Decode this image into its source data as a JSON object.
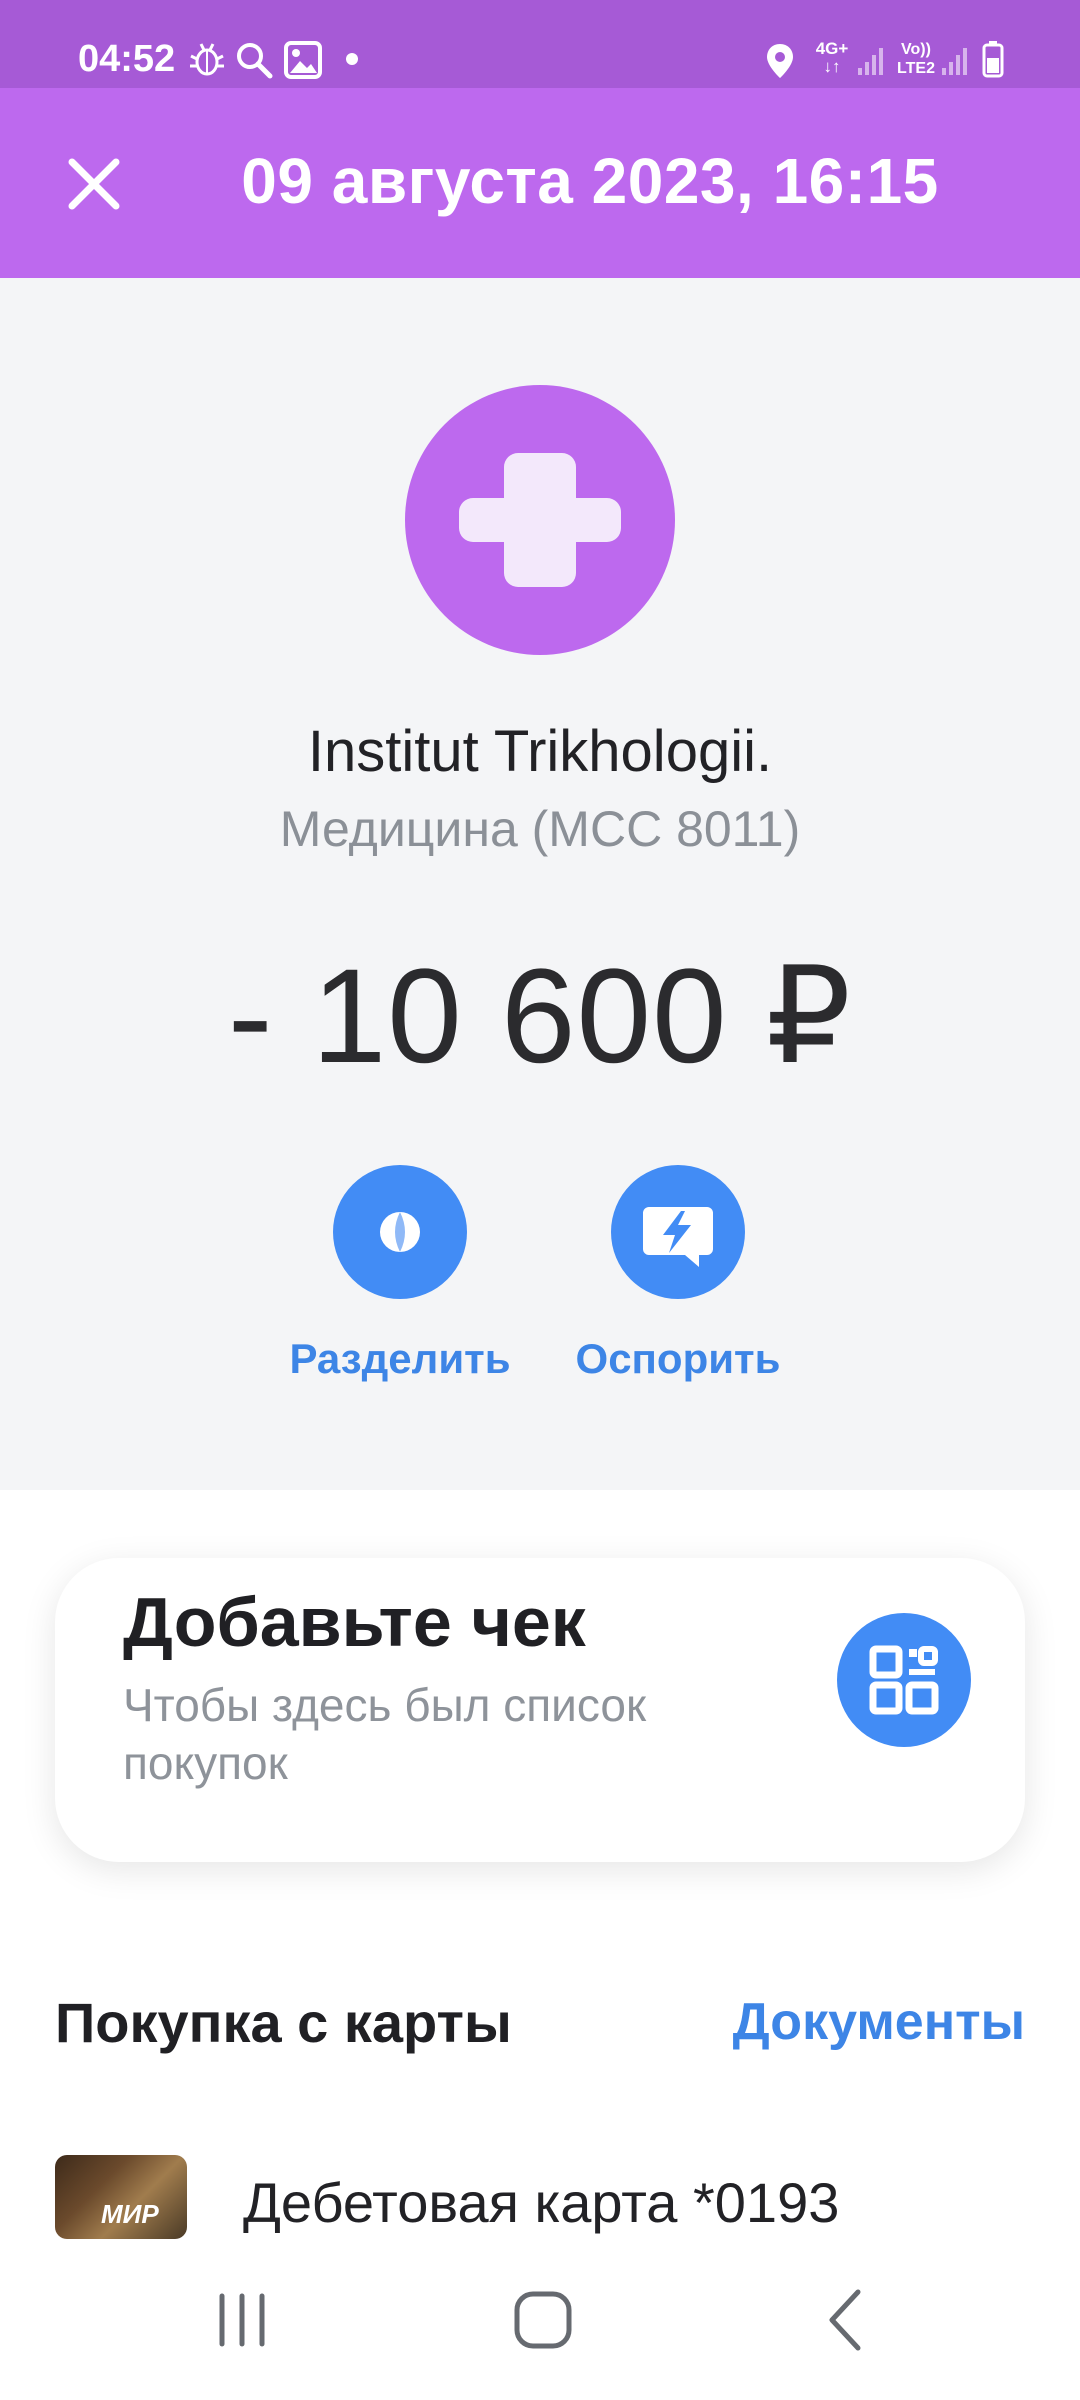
{
  "status_bar": {
    "time": "04:52",
    "icons": [
      "bug-icon",
      "search-icon",
      "gallery-icon",
      "notification-dot-icon",
      "location-icon",
      "network-4g-icon",
      "signal-icon",
      "volte-icon",
      "signal-icon",
      "battery-icon"
    ],
    "network_label": "4G+",
    "volte_label_top": "Vo))",
    "volte_label_bottom": "LTE2"
  },
  "header": {
    "title": "09 августа 2023, 16:15",
    "close_icon": "close-icon",
    "background": "#bd69ee"
  },
  "transaction": {
    "merchant_icon": "medical-cross-icon",
    "merchant_name": "Institut Trikhologii.",
    "category": "Медицина (MCC 8011)",
    "amount": "- 10 600 ₽"
  },
  "actions": [
    {
      "label": "Разделить",
      "icon": "split-icon"
    },
    {
      "label": "Оспорить",
      "icon": "dispute-icon"
    }
  ],
  "receipt": {
    "title": "Добавьте чек",
    "subtitle": "Чтобы здесь был список покупок",
    "icon": "qr-code-icon"
  },
  "purchase": {
    "title": "Покупка с карты",
    "documents_link": "Документы",
    "card_name": "Дебетовая карта *0193",
    "card_logo_text": "МИР"
  },
  "navigation": {
    "icons": [
      "recent-apps-icon",
      "home-icon",
      "back-icon"
    ]
  },
  "colors": {
    "accent_purple": "#bd69ee",
    "action_blue": "#428cf5",
    "link_blue": "#3d85e6"
  }
}
